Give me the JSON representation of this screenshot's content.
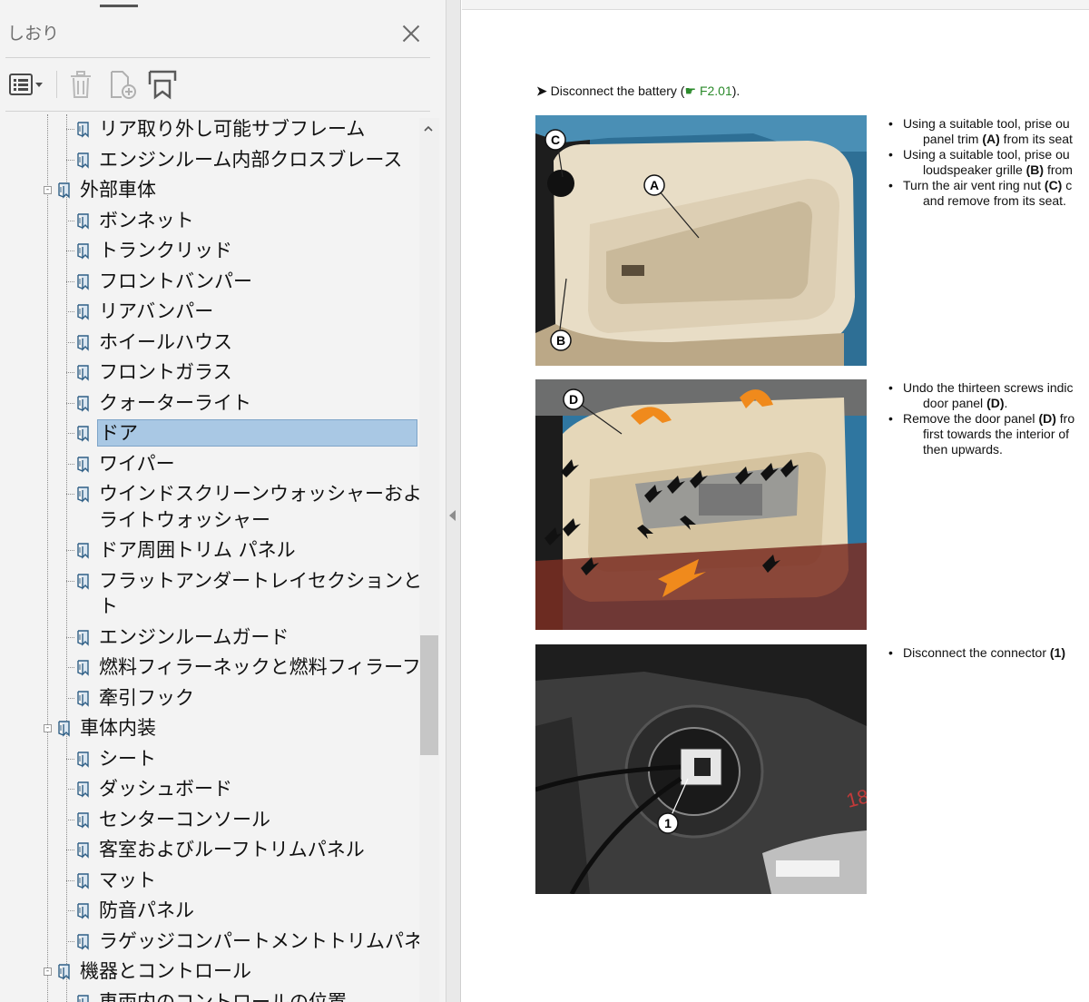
{
  "panel": {
    "title": "しおり",
    "toolbar": {
      "options_icon": "list-options-icon",
      "delete_icon": "trash-icon",
      "new_icon": "new-bookmark-icon",
      "expand_icon": "expand-bookmark-icon"
    },
    "items": [
      {
        "label": "リア取り外し可能サブフレーム",
        "level": 2
      },
      {
        "label": "エンジンルーム内部クロスブレース",
        "level": 2
      },
      {
        "label": "外部車体",
        "level": 1
      },
      {
        "label": "ボンネット",
        "level": 2
      },
      {
        "label": "トランクリッド",
        "level": 2
      },
      {
        "label": "フロントバンパー",
        "level": 2
      },
      {
        "label": "リアバンパー",
        "level": 2
      },
      {
        "label": "ホイールハウス",
        "level": 2
      },
      {
        "label": "フロントガラス",
        "level": 2
      },
      {
        "label": "クォーターライト",
        "level": 2
      },
      {
        "label": "ドア",
        "level": 2,
        "selected": true
      },
      {
        "label": "ワイパー",
        "level": 2
      },
      {
        "label": "ウインドスクリーンウォッシャーおよびヘッド",
        "label2": "ライトウォッシャー",
        "level": 2
      },
      {
        "label": "ドア周囲トリム パネル",
        "level": 2
      },
      {
        "label": "フラットアンダートレイセクションと車両リフ",
        "label2": "ト",
        "level": 2
      },
      {
        "label": "エンジンルームガード",
        "level": 2
      },
      {
        "label": "燃料フィラーネックと燃料フィラーフラップ",
        "level": 2
      },
      {
        "label": "牽引フック",
        "level": 2
      },
      {
        "label": "車体内装",
        "level": 1
      },
      {
        "label": "シート",
        "level": 2
      },
      {
        "label": "ダッシュボード",
        "level": 2
      },
      {
        "label": "センターコンソール",
        "level": 2
      },
      {
        "label": "客室およびルーフトリムパネル",
        "level": 2
      },
      {
        "label": "マット",
        "level": 2
      },
      {
        "label": "防音パネル",
        "level": 2
      },
      {
        "label": "ラゲッジコンパートメントトリムパネル",
        "level": 2
      },
      {
        "label": "機器とコントロール",
        "level": 1
      },
      {
        "label": "車両内のコントロールの位置",
        "level": 2
      }
    ]
  },
  "document": {
    "step1": {
      "prefix": "Disconnect the battery (",
      "ref": "F2.01",
      "suffix": ")."
    },
    "photo1": {
      "labels": [
        "A",
        "B",
        "C"
      ]
    },
    "photo2": {
      "labels": [
        "D"
      ]
    },
    "photo3": {
      "labels": [
        "1"
      ],
      "number": "18"
    },
    "block1": [
      {
        "t": "b",
        "parts": [
          "Using a suitable tool, prise ou"
        ]
      },
      {
        "t": "c",
        "parts": [
          "panel trim ",
          "(A)",
          " from its seat"
        ]
      },
      {
        "t": "b",
        "parts": [
          "Using a suitable tool, prise ou"
        ]
      },
      {
        "t": "c",
        "parts": [
          "loudspeaker grille ",
          "(B)",
          " from"
        ]
      },
      {
        "t": "b",
        "parts": [
          "Turn the air vent ring nut ",
          "(C)",
          " c"
        ]
      },
      {
        "t": "c",
        "parts": [
          "and remove from its seat."
        ]
      }
    ],
    "block2": [
      {
        "t": "b",
        "parts": [
          "Undo the thirteen screws indic"
        ]
      },
      {
        "t": "c",
        "parts": [
          "door panel ",
          "(D)",
          "."
        ]
      },
      {
        "t": "b",
        "parts": [
          "Remove the door panel ",
          "(D)",
          " fro"
        ]
      },
      {
        "t": "c",
        "parts": [
          "first towards the interior of"
        ]
      },
      {
        "t": "c",
        "parts": [
          "then upwards."
        ]
      }
    ],
    "block3": [
      {
        "t": "b",
        "parts": [
          "Disconnect the connector ",
          "(1)",
          " "
        ]
      }
    ],
    "colors": {
      "link": "#2b8a2b",
      "selection": "#a9c8e4",
      "arrow": "#f08a1c"
    }
  }
}
